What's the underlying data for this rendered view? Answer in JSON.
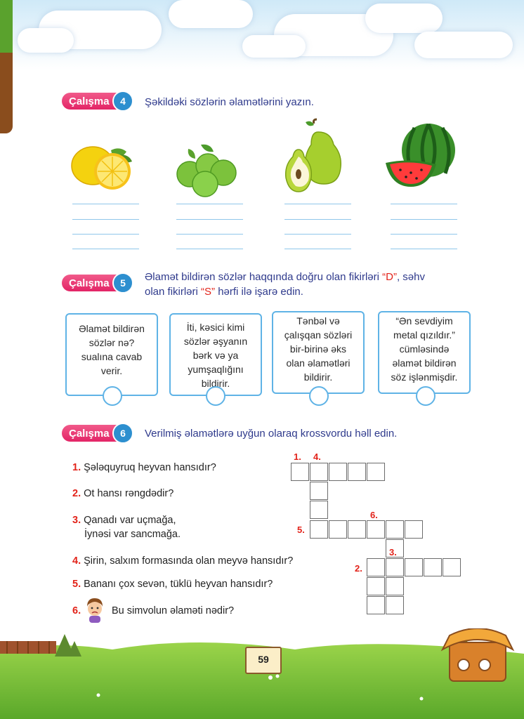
{
  "ex4": {
    "badge_label": "Çalışma",
    "badge_number": "4",
    "instruction": "Şəkildəki sözlərin əlamətlərini yazın."
  },
  "ex5": {
    "badge_label": "Çalışma",
    "badge_number": "5",
    "instruction_line1_a": "Əlamət bildirən sözlər haqqında doğru olan fikirləri ",
    "instruction_line1_d": "“D”",
    "instruction_line1_b": ", səhv",
    "instruction_line2_a": "olan fikirləri ",
    "instruction_line2_s": "“S”",
    "instruction_line2_b": " hərfi ilə işarə edin.",
    "cards": [
      [
        "Əlamət bildirən",
        "sözlər nə?",
        "sualına cavab",
        "verir."
      ],
      [
        "İti, kəsici kimi",
        "sözlər əşyanın",
        "bərk və ya",
        "yumşaqlığını",
        "bildirir."
      ],
      [
        "Tənbəl və",
        "çalışqan sözləri",
        "bir-birinə əks",
        "olan əlamətləri",
        "bildirir."
      ],
      [
        "“Ən sevdiyim",
        "metal qızıldır.”",
        "cümləsində",
        "əlamət bildirən",
        "söz işlənmişdir."
      ]
    ]
  },
  "ex6": {
    "badge_label": "Çalışma",
    "badge_number": "6",
    "instruction": "Verilmiş əlamətlərə uyğun olaraq krossvordu həll edin.",
    "questions": [
      {
        "num": "1.",
        "text": "Şələquyruq heyvan hansıdır?"
      },
      {
        "num": "2.",
        "text": "Ot hansı rəngdədir?"
      },
      {
        "num": "3.",
        "text": "Qanadı var uçmağa,"
      },
      {
        "num": "",
        "text": "İynəsi var sancmağa."
      },
      {
        "num": "4.",
        "text": "Şirin, salxım formasında olan meyvə hansıdır?"
      },
      {
        "num": "5.",
        "text": "Bananı çox sevən, tüklü heyvan hansıdır?"
      },
      {
        "num": "6.",
        "text": "Bu simvolun əlaməti nədir?"
      }
    ],
    "crossword_numbers": [
      "1.",
      "4.",
      "5.",
      "6.",
      "3.",
      "2."
    ]
  },
  "page_number": "59",
  "colors": {
    "badge": "#e32466",
    "badge_number": "#2d8fcf",
    "instruction": "#2f3a8c",
    "accent_red": "#e2231a",
    "card_border": "#5fb3e6"
  },
  "icons": [
    "lemon-image",
    "plums-image",
    "pears-image",
    "watermelon-image",
    "sad-child-icon",
    "house-image",
    "tree-image"
  ]
}
